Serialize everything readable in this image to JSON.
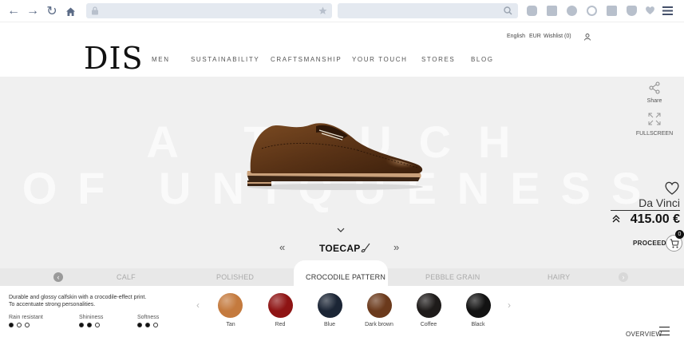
{
  "browser": {
    "icons": [
      "back-icon",
      "forward-icon",
      "reload-icon",
      "home-icon",
      "lock-icon",
      "bookmark-star-icon",
      "search-icon",
      "cloud-icon",
      "camera-icon",
      "alert-icon",
      "wifi-icon",
      "download-icon",
      "shield-icon",
      "heart-icon",
      "menu-icon"
    ]
  },
  "header": {
    "language": "English",
    "currency": "EUR",
    "wishlist": "Wishlist (0)",
    "logo": "DIS",
    "menu": [
      "MEN",
      "SUSTAINABILITY",
      "CRAFTSMANSHIP",
      "YOUR TOUCH",
      "STORES",
      "BLOG"
    ]
  },
  "hero": {
    "bg_line1": "A TOUCH",
    "bg_line2": "OF UNIQUENESS",
    "share_label": "Share",
    "fullscreen_label": "FULLSCREEN",
    "model_name": "Da Vinci",
    "price": "415.00 €",
    "proceed_label": "PROCEED",
    "cart_count": "0",
    "part_label": "TOECAP",
    "prev_symbol": "«",
    "next_symbol": "»"
  },
  "leather_tabs": {
    "items": [
      "CALF",
      "POLISHED",
      "CROCODILE PATTERN",
      "PEBBLE GRAIN",
      "HAIRY"
    ],
    "active_index": 2
  },
  "material": {
    "description_line1": "Durable and glossy calfskin with a crocodile-effect print.",
    "description_line2": "To accentuate strong personalities.",
    "properties": [
      {
        "label": "Rain resistant",
        "level": 1,
        "max": 3
      },
      {
        "label": "Shininess",
        "level": 2,
        "max": 3
      },
      {
        "label": "Softness",
        "level": 2,
        "max": 3
      }
    ]
  },
  "swatches": [
    {
      "label": "Tan",
      "color": "#c47a3e"
    },
    {
      "label": "Red",
      "color": "#8e1414"
    },
    {
      "label": "Blue",
      "color": "#1b2535"
    },
    {
      "label": "Dark brown",
      "color": "#6b3a1c"
    },
    {
      "label": "Coffee",
      "color": "#1e1b1a"
    },
    {
      "label": "Black",
      "color": "#121212"
    }
  ],
  "footer": {
    "overview_label": "OVERVIEW"
  }
}
